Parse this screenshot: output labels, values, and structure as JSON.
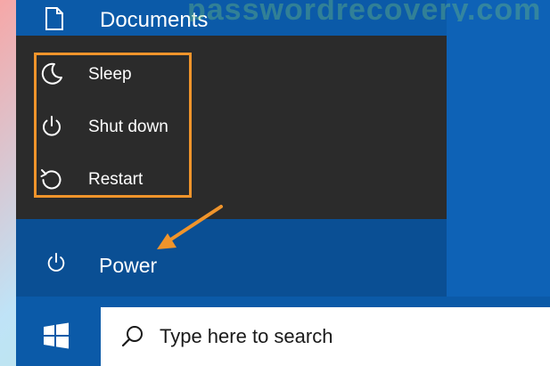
{
  "watermark": {
    "text": "passwordrecovery.com"
  },
  "start_menu": {
    "documents_label": "Documents",
    "documents_icon": "document-icon",
    "power_label": "Power",
    "power_icon": "power-icon"
  },
  "power_menu": {
    "items": [
      {
        "label": "Sleep",
        "icon": "moon-icon"
      },
      {
        "label": "Shut down",
        "icon": "power-icon"
      },
      {
        "label": "Restart",
        "icon": "restart-icon"
      }
    ],
    "highlight_color": "#f0942b"
  },
  "taskbar": {
    "start_icon": "windows-logo-icon",
    "search_icon": "search-icon",
    "search_placeholder": "Type here to search"
  },
  "colors": {
    "taskbar": "#0b5aa8",
    "start_menu": "#0a4f94",
    "power_menu": "#2b2b2b",
    "accent_annotation": "#f0942b"
  }
}
